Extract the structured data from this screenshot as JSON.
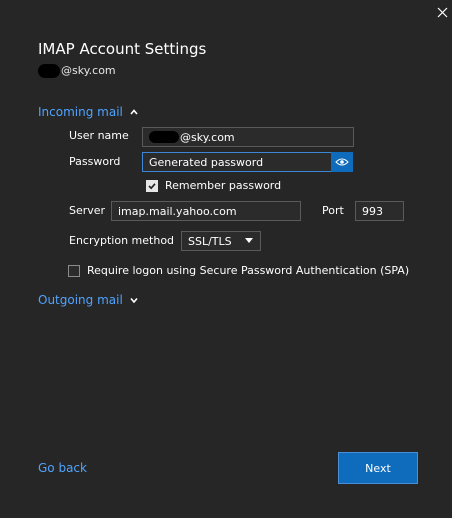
{
  "window": {
    "title": "IMAP Account Settings",
    "account_email_suffix": "@sky.com",
    "close_icon": "close-icon"
  },
  "incoming": {
    "label": "Incoming mail",
    "expanded": true,
    "username_label": "User name",
    "username_value_suffix": "@sky.com",
    "password_label": "Password",
    "password_value": "Generated password",
    "remember_label": "Remember password",
    "remember_checked": true,
    "server_label": "Server",
    "server_value": "imap.mail.yahoo.com",
    "port_label": "Port",
    "port_value": "993",
    "encryption_label": "Encryption method",
    "encryption_value": "SSL/TLS",
    "spa_label": "Require logon using Secure Password Authentication (SPA)",
    "spa_checked": false
  },
  "outgoing": {
    "label": "Outgoing mail",
    "expanded": false
  },
  "footer": {
    "back_label": "Go back",
    "next_label": "Next"
  },
  "colors": {
    "background": "#262626",
    "accent": "#4fa3ff",
    "primary_button": "#0f6cbd"
  }
}
